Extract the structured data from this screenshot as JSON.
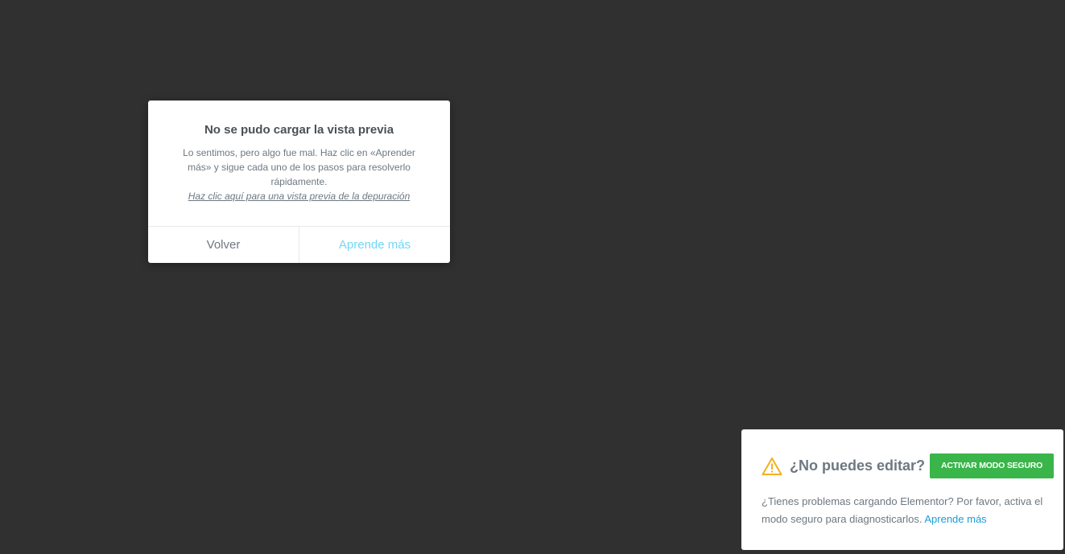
{
  "preview_dialog": {
    "title": "No se pudo cargar la vista previa",
    "message": "Lo sentimos, pero algo fue mal. Haz clic en «Aprender más» y sigue cada uno de los pasos para resolverlo rápidamente.",
    "debug_link": "Haz clic aquí para una vista previa de la depuración",
    "cancel_label": "Volver",
    "confirm_label": "Aprende más"
  },
  "safe_mode_notice": {
    "icon": "warning-icon",
    "title": "¿No puedes editar?",
    "button_label": "ACTIVAR MODO SEGURO",
    "message": "¿Tienes problemas cargando Elementor? Por favor, activa el modo seguro para diagnosticarlos.",
    "link_label": "Aprende más"
  },
  "colors": {
    "background": "#2f302f",
    "dialog_confirm": "#71d7f7",
    "safe_mode_button": "#39b54a",
    "link": "#1c9cd8",
    "warning": "#f2b01e"
  }
}
